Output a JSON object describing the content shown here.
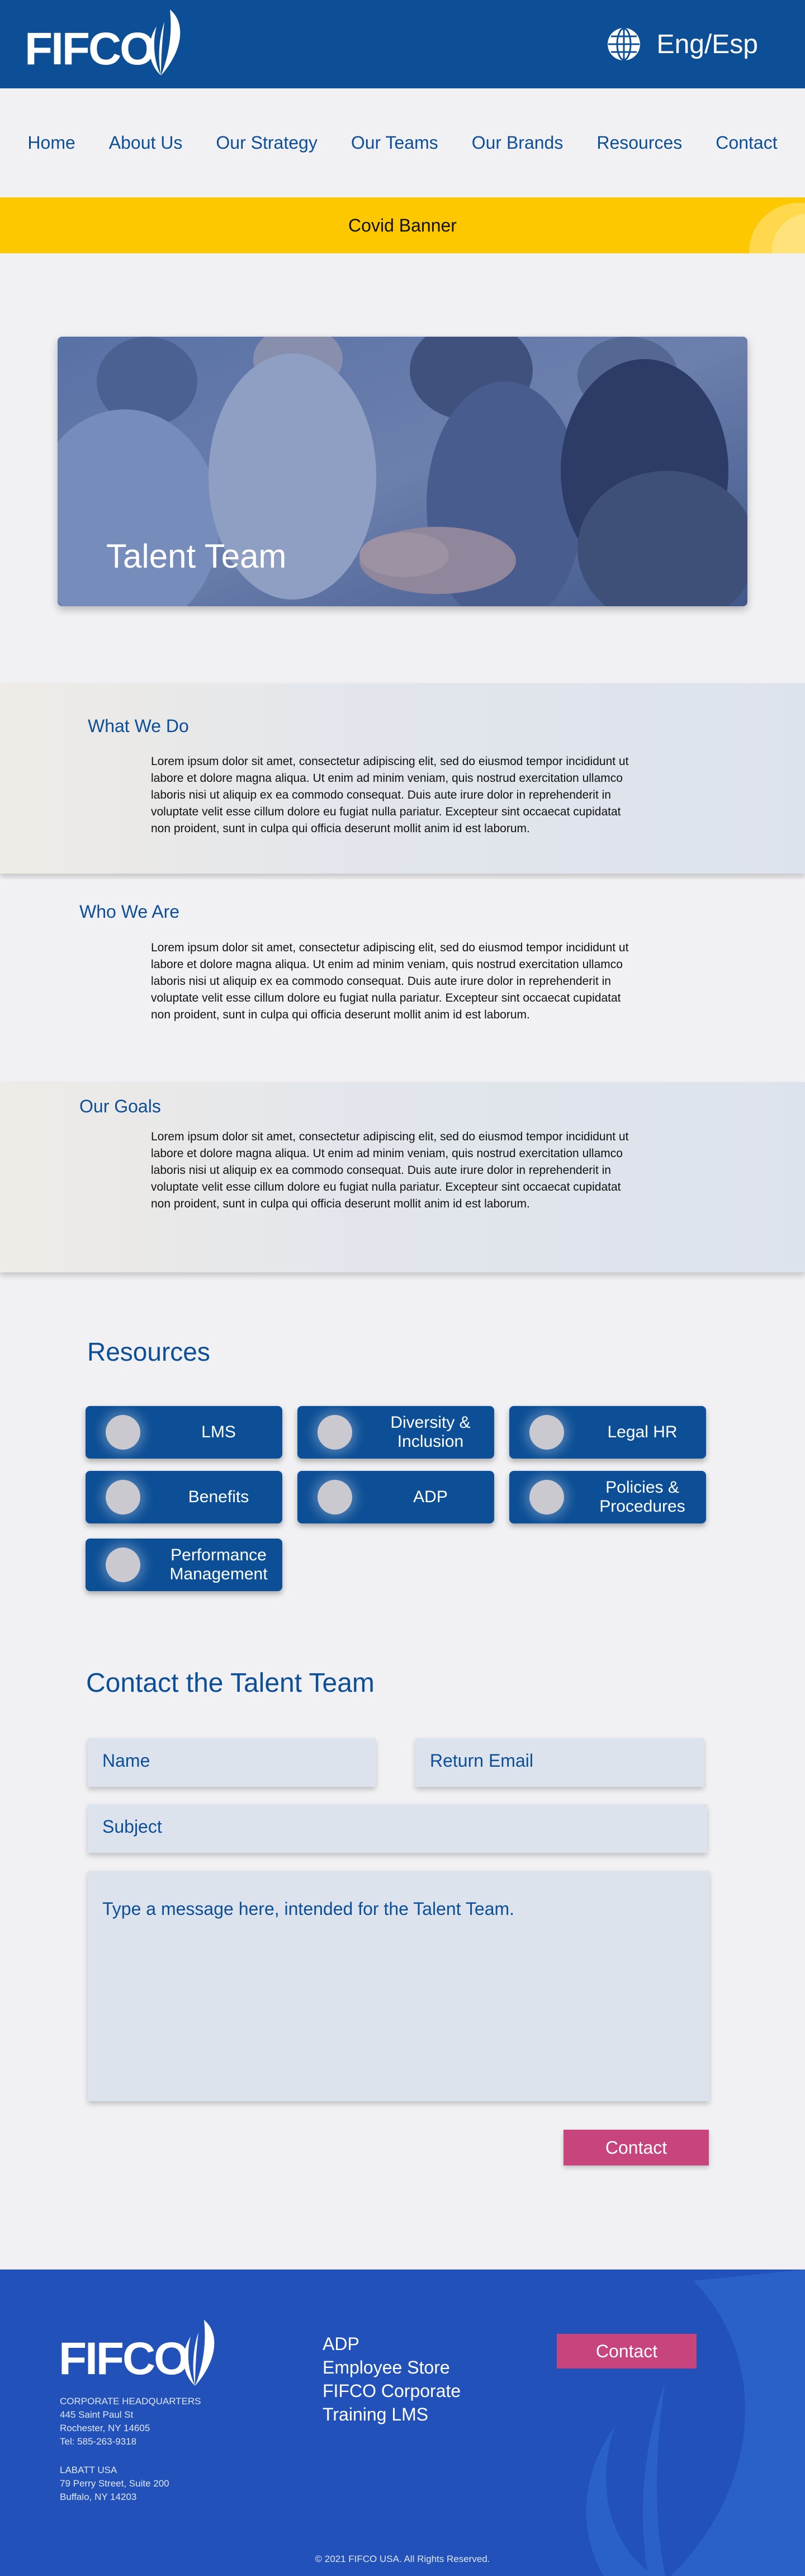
{
  "header": {
    "logo_text": "FIFCO",
    "lang_label": "Eng/Esp"
  },
  "nav": {
    "items": [
      "Home",
      "About Us",
      "Our Strategy",
      "Our Teams",
      "Our Brands",
      "Resources",
      "Contact"
    ]
  },
  "covid_banner": "Covid Banner",
  "hero": {
    "title": "Talent Team"
  },
  "sections": [
    {
      "title": "What We Do",
      "body": "Lorem ipsum dolor sit amet, consectetur adipiscing elit, sed do eiusmod tempor incididunt ut labore et dolore magna aliqua. Ut enim ad minim veniam, quis nostrud exercitation ullamco laboris nisi ut aliquip ex ea commodo consequat. Duis aute irure dolor in reprehenderit in voluptate velit esse cillum dolore eu fugiat nulla pariatur. Excepteur sint occaecat cupidatat non proident, sunt in culpa qui officia deserunt mollit anim id est laborum."
    },
    {
      "title": "Who We Are",
      "body": "Lorem ipsum dolor sit amet, consectetur adipiscing elit, sed do eiusmod tempor incididunt ut labore et dolore magna aliqua. Ut enim ad minim veniam, quis nostrud exercitation ullamco laboris nisi ut aliquip ex ea commodo consequat. Duis aute irure dolor in reprehenderit in voluptate velit esse cillum dolore eu fugiat nulla pariatur. Excepteur sint occaecat cupidatat non proident, sunt in culpa qui officia deserunt mollit anim id est laborum."
    },
    {
      "title": "Our Goals",
      "body": "Lorem ipsum dolor sit amet, consectetur adipiscing elit, sed do eiusmod tempor incididunt ut labore et dolore magna aliqua. Ut enim ad minim veniam, quis nostrud exercitation ullamco laboris nisi ut aliquip ex ea commodo consequat. Duis aute irure dolor in reprehenderit in voluptate velit esse cillum dolore eu fugiat nulla pariatur. Excepteur sint occaecat cupidatat non proident, sunt in culpa qui officia deserunt mollit anim id est laborum."
    }
  ],
  "resources": {
    "title": "Resources",
    "items": [
      "LMS",
      "Diversity & Inclusion",
      "Legal HR",
      "Benefits",
      "ADP",
      "Policies & Procedures",
      "Performance Management"
    ]
  },
  "contact": {
    "title": "Contact the Talent Team",
    "name_placeholder": "Name",
    "email_placeholder": "Return Email",
    "subject_placeholder": "Subject",
    "message_placeholder": "Type a message here, intended for the Talent Team.",
    "submit_label": "Contact"
  },
  "footer": {
    "logo_text": "FIFCO",
    "hq_lines": [
      "CORPORATE HEADQUARTERS",
      "445 Saint Paul St",
      "Rochester, NY 14605",
      "Tel: 585-263-9318"
    ],
    "labatt_lines": [
      "LABATT USA",
      "79 Perry Street, Suite 200",
      "Buffalo, NY 14203"
    ],
    "links": [
      "ADP",
      "Employee Store",
      "FIFCO Corporate",
      "Training LMS"
    ],
    "contact_label": "Contact",
    "copyright": "© 2021 FIFCO USA. All Rights Reserved."
  },
  "colors": {
    "brand_blue": "#0d4f96",
    "footer_blue": "#2252b9",
    "banner_yellow": "#fec800",
    "accent_pink": "#c8447d"
  }
}
